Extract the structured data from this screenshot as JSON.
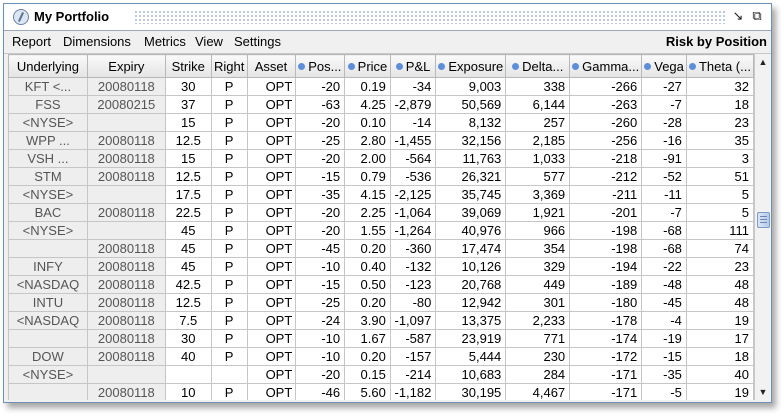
{
  "window": {
    "title": "My Portfolio",
    "minimize_icon": "minimize-icon",
    "restore_icon": "restore-icon"
  },
  "menu": {
    "items": [
      "Report",
      "Dimensions",
      "Metrics",
      "View",
      "Settings"
    ],
    "risk_label": "Risk by Position"
  },
  "columns": [
    "Underlying",
    "Expiry",
    "Strike",
    "Right",
    "Asset",
    "Pos...",
    "Price",
    "P&L",
    "Exposure",
    "Delta...",
    "Gamma...",
    "Vega",
    "Theta (..."
  ],
  "rows": [
    [
      "KFT <...",
      "20080118",
      "30",
      "P",
      "OPT",
      "-20",
      "0.19",
      "-34",
      "9,003",
      "338",
      "-266",
      "-27",
      "32"
    ],
    [
      "FSS",
      "20080215",
      "37",
      "P",
      "OPT",
      "-63",
      "4.25",
      "-2,879",
      "50,569",
      "6,144",
      "-263",
      "-7",
      "18"
    ],
    [
      "<NYSE>",
      "",
      "15",
      "P",
      "OPT",
      "-20",
      "0.10",
      "-14",
      "8,132",
      "257",
      "-260",
      "-28",
      "23"
    ],
    [
      "WPP ...",
      "20080118",
      "12.5",
      "P",
      "OPT",
      "-25",
      "2.80",
      "-1,455",
      "32,156",
      "2,185",
      "-256",
      "-16",
      "35"
    ],
    [
      "VSH ...",
      "20080118",
      "15",
      "P",
      "OPT",
      "-20",
      "2.00",
      "-564",
      "11,763",
      "1,033",
      "-218",
      "-91",
      "3"
    ],
    [
      "STM",
      "20080118",
      "12.5",
      "P",
      "OPT",
      "-15",
      "0.79",
      "-536",
      "26,321",
      "577",
      "-212",
      "-52",
      "51"
    ],
    [
      "<NYSE>",
      "",
      "17.5",
      "P",
      "OPT",
      "-35",
      "4.15",
      "-2,125",
      "35,745",
      "3,369",
      "-211",
      "-11",
      "5"
    ],
    [
      "BAC",
      "20080118",
      "22.5",
      "P",
      "OPT",
      "-20",
      "2.25",
      "-1,064",
      "39,069",
      "1,921",
      "-201",
      "-7",
      "5"
    ],
    [
      "<NYSE>",
      "",
      "45",
      "P",
      "OPT",
      "-20",
      "1.55",
      "-1,264",
      "40,976",
      "966",
      "-198",
      "-68",
      "111"
    ],
    [
      "",
      "20080118",
      "45",
      "P",
      "OPT",
      "-45",
      "0.20",
      "-360",
      "17,474",
      "354",
      "-198",
      "-68",
      "74"
    ],
    [
      "INFY",
      "20080118",
      "45",
      "P",
      "OPT",
      "-10",
      "0.40",
      "-132",
      "10,126",
      "329",
      "-194",
      "-22",
      "23"
    ],
    [
      "<NASDAQ",
      "20080118",
      "42.5",
      "P",
      "OPT",
      "-15",
      "0.50",
      "-123",
      "20,768",
      "449",
      "-189",
      "-48",
      "48"
    ],
    [
      "INTU",
      "20080118",
      "12.5",
      "P",
      "OPT",
      "-25",
      "0.20",
      "-80",
      "12,942",
      "301",
      "-180",
      "-45",
      "48"
    ],
    [
      "<NASDAQ",
      "20080118",
      "7.5",
      "P",
      "OPT",
      "-24",
      "3.90",
      "-1,097",
      "13,375",
      "2,233",
      "-178",
      "-4",
      "19"
    ],
    [
      "",
      "20080118",
      "30",
      "P",
      "OPT",
      "-10",
      "1.67",
      "-587",
      "23,919",
      "771",
      "-174",
      "-19",
      "17"
    ],
    [
      "DOW",
      "20080118",
      "40",
      "P",
      "OPT",
      "-10",
      "0.20",
      "-157",
      "5,444",
      "230",
      "-172",
      "-15",
      "18"
    ],
    [
      "<NYSE>",
      "",
      "",
      "",
      "OPT",
      "-20",
      "0.15",
      "-214",
      "10,683",
      "284",
      "-171",
      "-35",
      "40"
    ],
    [
      "",
      "20080118",
      "10",
      "P",
      "OPT",
      "-46",
      "5.60",
      "-1,182",
      "30,195",
      "4,467",
      "-171",
      "-5",
      "19"
    ]
  ],
  "scrollbar": {
    "up_icon": "scroll-up-icon",
    "down_icon": "scroll-down-icon"
  }
}
